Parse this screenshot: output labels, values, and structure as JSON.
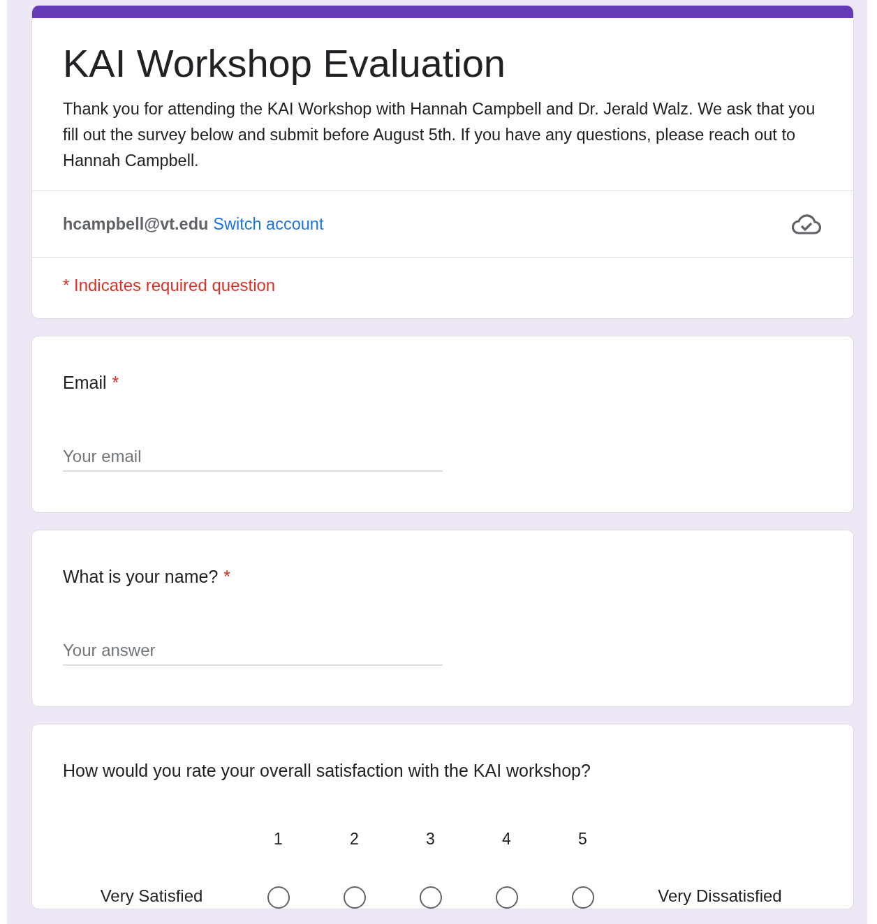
{
  "form": {
    "title": "KAI Workshop Evaluation",
    "description": "Thank you for attending the KAI Workshop with Hannah Campbell and Dr. Jerald Walz. We ask that you fill out the survey below and submit before August 5th. If you have any questions, please reach out to Hannah Campbell.",
    "account": {
      "email": "hcampbell@vt.edu",
      "switch_link": "Switch account"
    },
    "required_note": "* Indicates required question"
  },
  "questions": [
    {
      "kind": "text",
      "title": "Email",
      "required_mark": "*",
      "placeholder": "Your email"
    },
    {
      "kind": "text",
      "title": "What is your name?",
      "required_mark": "*",
      "placeholder": "Your answer"
    },
    {
      "kind": "scale",
      "title": "How would you rate your overall satisfaction with the KAI workshop?",
      "low_label": "Very Satisfied",
      "high_label": "Very Dissatisfied",
      "options": [
        {
          "label": "1",
          "selected": false
        },
        {
          "label": "2",
          "selected": false
        },
        {
          "label": "3",
          "selected": false
        },
        {
          "label": "4",
          "selected": false
        },
        {
          "label": "5",
          "selected": false
        }
      ]
    }
  ]
}
